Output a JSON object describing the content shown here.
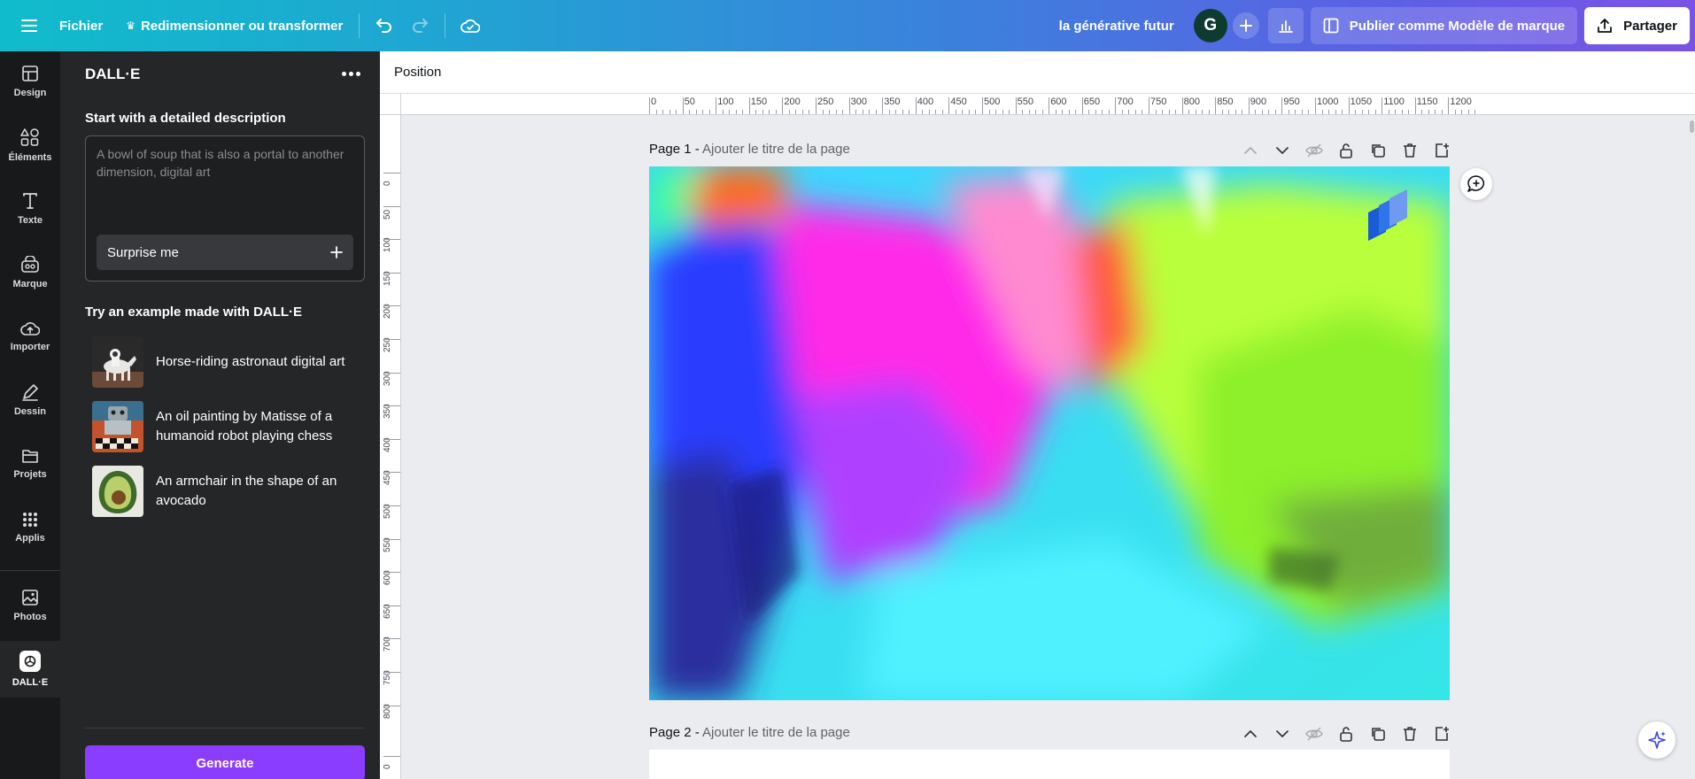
{
  "topbar": {
    "menu_icon": "hamburger-icon",
    "file_label": "Fichier",
    "resize_label": "Redimensionner ou transformer",
    "doc_title": "la générative futur",
    "avatar_initial": "G",
    "publish_label": "Publier comme Modèle de marque",
    "share_label": "Partager"
  },
  "rail": {
    "items": [
      {
        "label": "Design",
        "icon": "layout-icon"
      },
      {
        "label": "Éléments",
        "icon": "shapes-icon"
      },
      {
        "label": "Texte",
        "icon": "text-icon"
      },
      {
        "label": "Marque",
        "icon": "brand-icon"
      },
      {
        "label": "Importer",
        "icon": "cloud-upload-icon"
      },
      {
        "label": "Dessin",
        "icon": "pen-icon"
      },
      {
        "label": "Projets",
        "icon": "folder-icon"
      },
      {
        "label": "Applis",
        "icon": "apps-grid-icon"
      },
      {
        "label": "Photos",
        "icon": "image-icon"
      },
      {
        "label": "DALL·E",
        "icon": "openai-icon"
      }
    ]
  },
  "panel": {
    "title": "DALL·E",
    "description_heading": "Start with a detailed description",
    "prompt_placeholder": "A bowl of soup that is also a portal to another dimension, digital art",
    "prompt_value": "",
    "surprise_label": "Surprise me",
    "examples_heading": "Try an example made with DALL·E",
    "examples": [
      {
        "label": "Horse-riding astronaut digital art"
      },
      {
        "label": "An oil painting by Matisse of a humanoid robot playing chess"
      },
      {
        "label": "An armchair in the shape of an avocado"
      }
    ],
    "generate_label": "Generate"
  },
  "context_bar": {
    "position_label": "Position"
  },
  "rulers": {
    "horizontal": [
      "0",
      "50",
      "100",
      "150",
      "200",
      "250",
      "300",
      "350",
      "400",
      "450",
      "500",
      "550",
      "600",
      "650",
      "700",
      "750",
      "800",
      "850",
      "900",
      "950",
      "1000",
      "1050",
      "1100",
      "1150",
      "1200"
    ],
    "vertical": [
      "0",
      "50",
      "100",
      "150",
      "200",
      "250",
      "300",
      "350",
      "400",
      "450",
      "500",
      "550",
      "600",
      "650",
      "700",
      "750",
      "800",
      "0"
    ]
  },
  "pages": [
    {
      "label": "Page 1 - ",
      "title_placeholder": "Ajouter le titre de la page"
    },
    {
      "label": "Page 2 - ",
      "title_placeholder": "Ajouter le titre de la page"
    }
  ],
  "colors": {
    "accent": "#8b3dff",
    "panel_bg": "#252627",
    "rail_bg": "#18191b",
    "avatar_bg": "#0f3b2e"
  }
}
